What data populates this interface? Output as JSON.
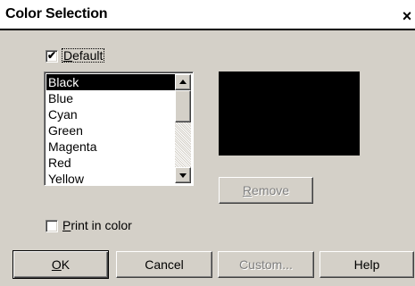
{
  "window": {
    "title": "Color Selection",
    "close_label": "×"
  },
  "default_checkbox": {
    "checked": true,
    "label_key": "D",
    "label_rest": "efault"
  },
  "color_list": {
    "selected": "Black",
    "items": [
      "Black",
      "Blue",
      "Cyan",
      "Green",
      "Magenta",
      "Red",
      "Yellow"
    ]
  },
  "preview": {
    "color": "#000000"
  },
  "remove_button": {
    "label_key": "R",
    "label_rest": "emove",
    "enabled": false
  },
  "print_checkbox": {
    "checked": false,
    "label_key": "P",
    "label_rest": "rint in color"
  },
  "buttons": {
    "ok_key": "O",
    "ok_rest": "K",
    "cancel": "Cancel",
    "custom": "Custom...",
    "help": "Help"
  }
}
